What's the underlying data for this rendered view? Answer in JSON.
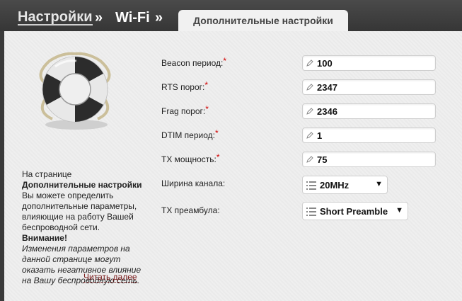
{
  "breadcrumb": {
    "settings": "Настройки",
    "separator": "»",
    "wifi": "Wi-Fi"
  },
  "tab": {
    "label": "Дополнительные настройки"
  },
  "sidebar": {
    "icon": "lifebuoy-icon",
    "line1": "На странице",
    "line2": "Дополнительные настройки",
    "line3": "Вы можете определить дополнительные параметры, влияющие на работу Вашей беспроводной сети.",
    "warning_title": "Внимание!",
    "warning_text": "Изменения параметров на данной странице могут оказать негативное влияние на Вашу беспроводную сеть.",
    "read_more": "Читать далее"
  },
  "form": {
    "required_mark": "*",
    "beacon": {
      "label": "Beacon период:",
      "value": "100"
    },
    "rts": {
      "label": "RTS порог:",
      "value": "2347"
    },
    "frag": {
      "label": "Frag порог:",
      "value": "2346"
    },
    "dtim": {
      "label": "DTIM период:",
      "value": "1"
    },
    "tx_power": {
      "label": "TX мощность:",
      "value": "75"
    },
    "channel_width": {
      "label": "Ширина канала:",
      "value": "20MHz"
    },
    "tx_preamble": {
      "label": "TX преамбула:",
      "value": "Short Preamble"
    }
  },
  "colors": {
    "required": "#d10000",
    "read_more": "#7a1a1a"
  }
}
